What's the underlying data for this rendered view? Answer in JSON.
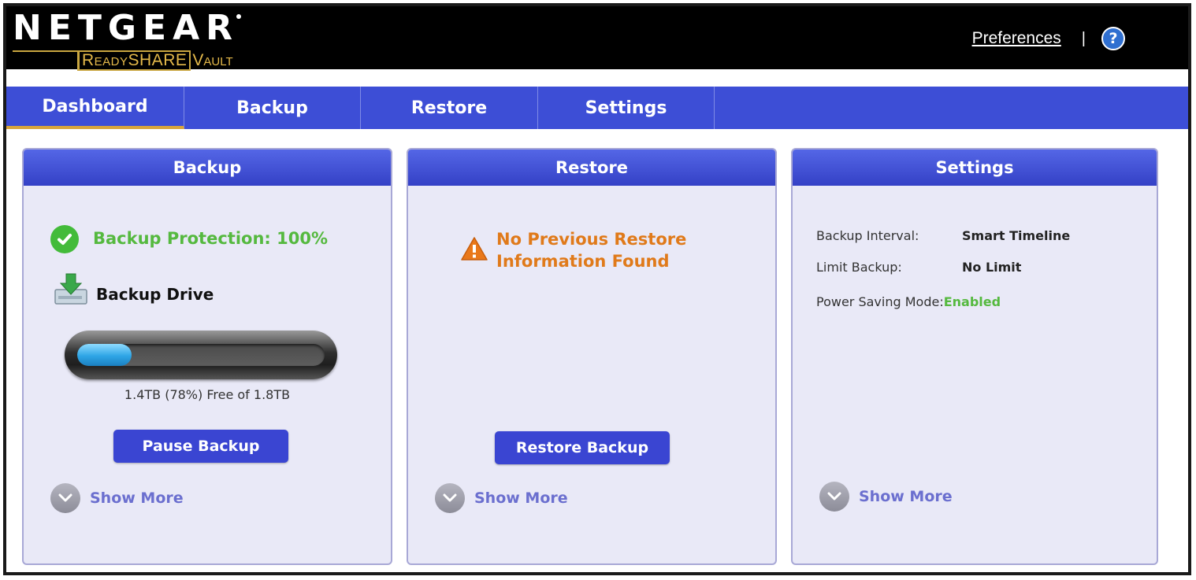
{
  "header": {
    "logo_main": "NETGEAR",
    "logo_readyshare": "ReadySHARE",
    "logo_vault": "Vault",
    "preferences_label": "Preferences",
    "separator": "|",
    "help_symbol": "?"
  },
  "tabs": [
    {
      "label": "Dashboard",
      "active": true
    },
    {
      "label": "Backup",
      "active": false
    },
    {
      "label": "Restore",
      "active": false
    },
    {
      "label": "Settings",
      "active": false
    }
  ],
  "backup_panel": {
    "title": "Backup",
    "protection_text": "Backup Protection: 100%",
    "drive_label": "Backup Drive",
    "used_fraction": 0.22,
    "storage_text": "1.4TB (78%) Free of 1.8TB",
    "pause_button": "Pause Backup",
    "show_more": "Show More"
  },
  "restore_panel": {
    "title": "Restore",
    "warning_line1": "No Previous Restore",
    "warning_line2": "Information Found",
    "restore_button": "Restore Backup",
    "show_more": "Show More"
  },
  "settings_panel": {
    "title": "Settings",
    "interval_label": "Backup Interval:",
    "interval_value": "Smart Timeline",
    "limit_label": "Limit Backup:",
    "limit_value": "No Limit",
    "power_label": "Power Saving Mode:",
    "power_value": "Enabled",
    "show_more": "Show More"
  },
  "colors": {
    "tab_bar": "#3d4ed6",
    "panel_bg": "#e9e9f7",
    "success_green": "#55b93f",
    "warning_orange": "#e07a1a",
    "button_blue": "#3a45d2",
    "logo_gold": "#e4b94a"
  },
  "icons": [
    "help-icon",
    "check-circle-icon",
    "backup-drive-icon",
    "warning-icon",
    "chevron-down-icon"
  ]
}
